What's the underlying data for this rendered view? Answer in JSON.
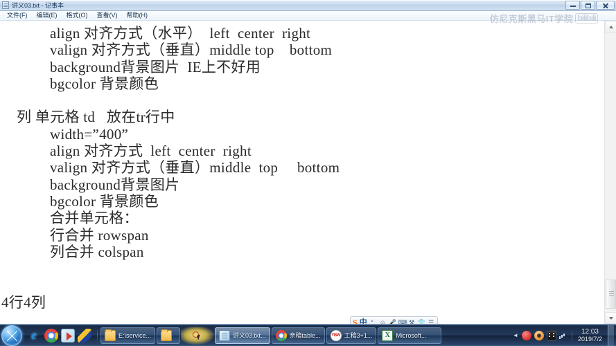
{
  "window": {
    "title": "讲义03.txt - 记事本",
    "icon": "notepad-icon",
    "controls": {
      "minimize": "最小化",
      "maximize": "最大化",
      "close": "关闭"
    }
  },
  "menu": {
    "items": [
      {
        "label": "文件(F)"
      },
      {
        "label": "编辑(E)"
      },
      {
        "label": "格式(O)"
      },
      {
        "label": "查看(V)"
      },
      {
        "label": "帮助(H)"
      }
    ]
  },
  "watermark": {
    "text": "仿尼克斯黑马IT学院",
    "logo": "bilibili"
  },
  "editor": {
    "lines": [
      {
        "text": "align 对齐方式（水平）  left  center  right",
        "indent": 2
      },
      {
        "text": "valign 对齐方式（垂直）middle top    bottom",
        "indent": 2
      },
      {
        "text": "background背景图片  IE上不好用",
        "indent": 2
      },
      {
        "text": "bgcolor 背景颜色",
        "indent": 2
      },
      {
        "text": "",
        "indent": 0
      },
      {
        "text": "列 单元格 td   放在tr行中",
        "indent": 1
      },
      {
        "text": "width=”400”",
        "indent": 2
      },
      {
        "text": "align 对齐方式  left  center  right",
        "indent": 2
      },
      {
        "text": "valign 对齐方式（垂直）middle  top     bottom",
        "indent": 2
      },
      {
        "text": "background背景图片",
        "indent": 2
      },
      {
        "text": "bgcolor 背景颜色",
        "indent": 2
      },
      {
        "text": "合并单元格：",
        "indent": 2
      },
      {
        "text": "行合并 rowspan",
        "indent": 2
      },
      {
        "text": "列合并 colspan",
        "indent": 2
      },
      {
        "text": "",
        "indent": 0
      },
      {
        "text": "",
        "indent": 0
      },
      {
        "text": "4行4列",
        "indent": 0
      }
    ],
    "scrollbar": {
      "up_arrow": "▲",
      "down_arrow": "▼"
    }
  },
  "ime": {
    "logo": "S",
    "mode": "中",
    "icons": [
      {
        "name": "comma-icon",
        "glyph": "°,"
      },
      {
        "name": "emoji-icon",
        "glyph": "☺"
      },
      {
        "name": "microphone-icon",
        "glyph": "🎤"
      },
      {
        "name": "keyboard-icon",
        "glyph": "⌨"
      },
      {
        "name": "toolbox-icon",
        "glyph": "⚒"
      },
      {
        "name": "skin-icon",
        "glyph": "👕"
      },
      {
        "name": "menu-icon",
        "glyph": "☰"
      }
    ]
  },
  "taskbar": {
    "start_label": "开始",
    "quick_launch": [
      {
        "name": "internet-explorer-icon",
        "glyph": "e"
      },
      {
        "name": "chrome-icon",
        "glyph": ""
      },
      {
        "name": "media-player-icon",
        "glyph": ""
      },
      {
        "name": "pen-tool-icon",
        "glyph": ""
      }
    ],
    "buttons": [
      {
        "label": "E:\\service...",
        "icon": "folder-icon",
        "active": false
      },
      {
        "label": "",
        "icon": "folder-icon",
        "active": false
      },
      {
        "label": "讲义03.txt...",
        "icon": "notepad-icon",
        "active": true
      },
      {
        "label": "亲稿table...",
        "icon": "chrome-icon",
        "active": false
      },
      {
        "label": "工稿3+1...",
        "icon": "ybw-icon",
        "active": false
      },
      {
        "label": "Microsoft...",
        "icon": "excel-icon",
        "active": false
      }
    ],
    "tray": {
      "chevron": "◄",
      "icons": [
        {
          "name": "recording-indicator-icon"
        },
        {
          "name": "qq-icon"
        },
        {
          "name": "video-icon"
        },
        {
          "name": "volume-icon"
        }
      ],
      "clock": {
        "time": "12:03",
        "date": "2019/7/2"
      }
    }
  }
}
